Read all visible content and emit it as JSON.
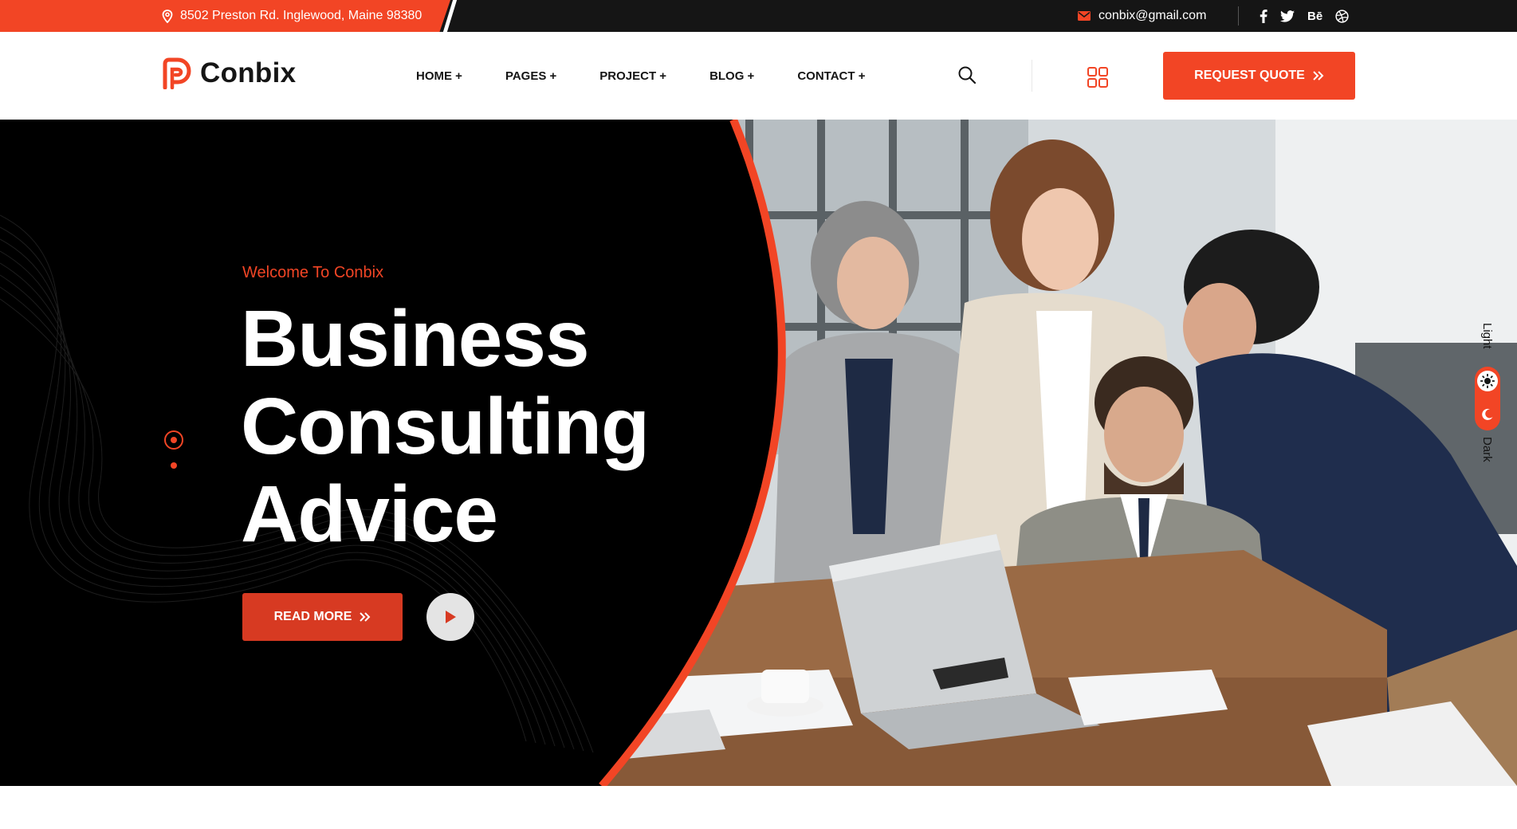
{
  "topbar": {
    "address": "8502 Preston Rd. Inglewood, Maine 98380",
    "email": "conbix@gmail.com",
    "socials": [
      {
        "icon": "facebook-icon",
        "label": "f"
      },
      {
        "icon": "twitter-icon",
        "label": "🐦"
      },
      {
        "icon": "behance-icon",
        "label": "Bē"
      },
      {
        "icon": "dribbble-icon",
        "label": ""
      }
    ]
  },
  "header": {
    "logo_text": "Conbix",
    "nav": [
      "HOME +",
      "PAGES +",
      "PROJECT +",
      "BLOG +",
      "CONTACT +"
    ],
    "quote_label": "REQUEST QUOTE"
  },
  "hero": {
    "welcome": "Welcome To Conbix",
    "title_lines": [
      "Business",
      "Consulting",
      "Advice"
    ],
    "read_more_label": "READ MORE"
  },
  "theme_switch": {
    "light_label": "Light",
    "dark_label": "Dark"
  },
  "colors": {
    "accent": "#f24525",
    "dark": "#151515",
    "hero_bg": "#000000"
  }
}
